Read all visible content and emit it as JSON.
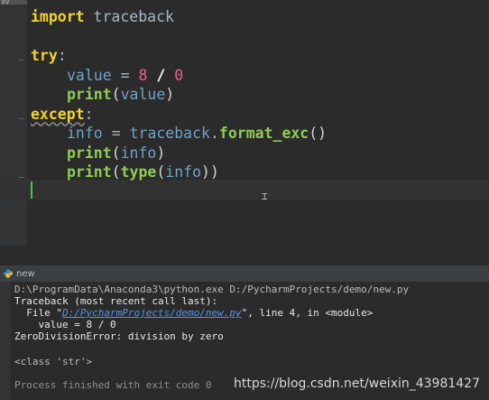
{
  "editor": {
    "file_tab_stub": "py",
    "code": {
      "import_kw": "import",
      "import_module": "traceback",
      "try_kw": "try",
      "colon": ":",
      "value_var": "value",
      "eq": "=",
      "num_8": "8",
      "div": "/",
      "num_0": "0",
      "print_fn": "print",
      "lparen": "(",
      "rparen": ")",
      "except_kw": "except",
      "info_var": "info",
      "traceback_mod": "traceback",
      "dot": ".",
      "format_exc": "format_exc",
      "empty_parens": "()",
      "type_fn": "type"
    }
  },
  "run_panel": {
    "tab_label": "new",
    "console": {
      "command": "D:\\ProgramData\\Anaconda3\\python.exe D:/PycharmProjects/demo/new.py",
      "tb_header": "Traceback (most recent call last):",
      "file_prefix": "  File \"",
      "file_link": "D:/PycharmProjects/demo/new.py",
      "file_suffix": "\", line 4, in <module>",
      "code_line": "    value = 8 / 0",
      "error": "ZeroDivisionError: division by zero",
      "output": "<class 'str'>",
      "exit": "Process finished with exit code 0"
    }
  },
  "watermark": "https://blog.csdn.net/weixin_43981427"
}
